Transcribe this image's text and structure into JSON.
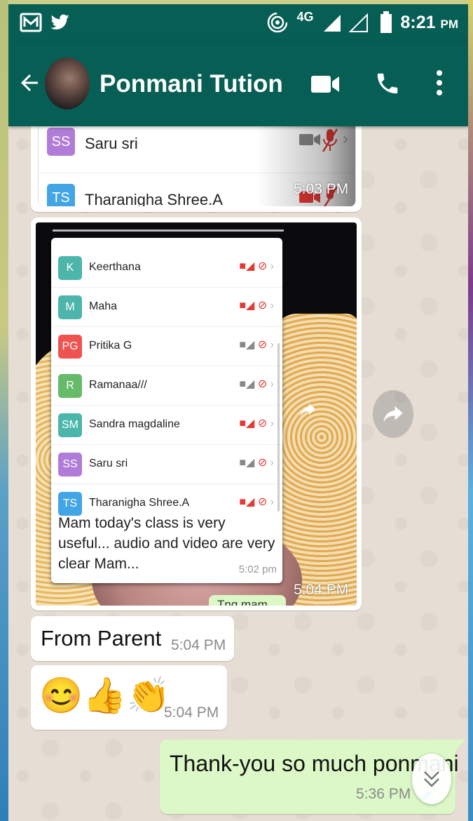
{
  "colors": {
    "header": "#075e54",
    "wallpaper": "#e6ddd4",
    "outgoing": "#dcf8c6",
    "muted_red": "#e53935"
  },
  "statusbar": {
    "network": "4G",
    "time": "8:21",
    "ampm": "PM",
    "icons": [
      "gmail-icon",
      "twitter-icon",
      "hotspot-icon",
      "signal-icon",
      "battery-icon"
    ]
  },
  "header": {
    "title": "Ponmani Tution",
    "icons": [
      "back-arrow-icon",
      "video-call-icon",
      "phone-icon",
      "more-vert-icon"
    ]
  },
  "messages": {
    "shot1": {
      "participants": [
        {
          "initials": "SS",
          "name": "Saru sri",
          "color": "#b07cd8"
        },
        {
          "initials": "TS",
          "name": "Tharanigha Shree.A",
          "color": "#42a5e6"
        }
      ],
      "time": "5:03 PM"
    },
    "shot2": {
      "participants": [
        {
          "initials": "K",
          "name": "Keerthana",
          "color": "#4db6ac"
        },
        {
          "initials": "M",
          "name": "Maha",
          "color": "#4db6ac"
        },
        {
          "initials": "PG",
          "name": "Pritika G",
          "color": "#ef5350"
        },
        {
          "initials": "R",
          "name": "Ramanaa///",
          "color": "#66bb6a"
        },
        {
          "initials": "SM",
          "name": "Sandra magdaline",
          "color": "#4db6ac"
        },
        {
          "initials": "SS",
          "name": "Saru sri",
          "color": "#b07cd8"
        },
        {
          "initials": "TS",
          "name": "Tharanigha Shree.A",
          "color": "#42a5e6"
        }
      ],
      "quoted_message": "Mam today's class is very useful... audio and video are very clear Mam...",
      "quoted_time": "5:02 pm",
      "reply_peek": "Tng mam",
      "time": "5:04 PM"
    },
    "from_parent": {
      "text": "From Parent",
      "time": "5:04 PM"
    },
    "emoji": {
      "text": "😊👍👏",
      "time": "5:04 PM"
    },
    "outgoing": {
      "text": "Thank-you so much ponmani",
      "time": "5:36 PM"
    }
  }
}
